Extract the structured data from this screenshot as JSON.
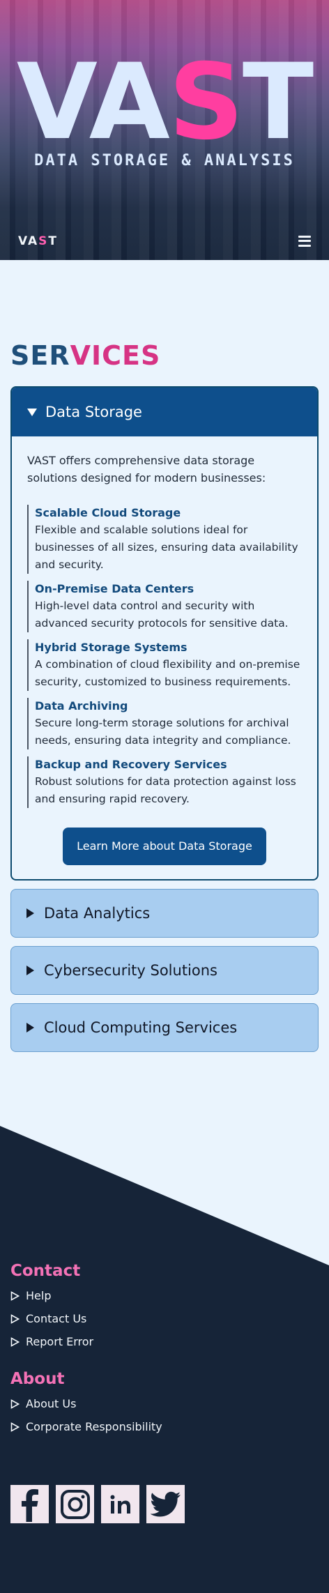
{
  "hero": {
    "title_before": "VA",
    "title_accent": "S",
    "title_after": "T",
    "subtitle": "DATA STORAGE & ANALYSIS"
  },
  "nav": {
    "logo_before": "VA",
    "logo_accent": "S",
    "logo_after": "T",
    "menu_icon": "hamburger-icon"
  },
  "services": {
    "title_before": "SER",
    "title_accent": "VICES",
    "open_item": {
      "label": "Data Storage",
      "intro": "VAST offers comprehensive data storage solutions designed for modern businesses:",
      "features": [
        {
          "title": "Scalable Cloud Storage",
          "desc": "Flexible and scalable solutions ideal for businesses of all sizes, ensuring data availability and security."
        },
        {
          "title": "On-Premise Data Centers",
          "desc": "High-level data control and security with advanced security protocols for sensitive data."
        },
        {
          "title": "Hybrid Storage Systems",
          "desc": "A combination of cloud flexibility and on-premise security, customized to business requirements."
        },
        {
          "title": "Data Archiving",
          "desc": "Secure long-term storage solutions for archival needs, ensuring data integrity and compliance."
        },
        {
          "title": "Backup and Recovery Services",
          "desc": "Robust solutions for data protection against loss and ensuring rapid recovery."
        }
      ],
      "button_label": "Learn More about Data Storage"
    },
    "closed_items": [
      {
        "label": "Data Analytics"
      },
      {
        "label": "Cybersecurity Solutions"
      },
      {
        "label": "Cloud Computing Services"
      }
    ]
  },
  "footer": {
    "contact": {
      "heading": "Contact",
      "links": [
        "Help",
        "Contact Us",
        "Report Error"
      ]
    },
    "about": {
      "heading": "About",
      "links": [
        "About Us",
        "Corporate Responsibility"
      ]
    },
    "socials": [
      "facebook-icon",
      "instagram-icon",
      "linkedin-icon",
      "twitter-icon"
    ]
  },
  "colors": {
    "accent_pink": "#ff3ea0",
    "primary_blue": "#0e4f8c",
    "footer_bg": "#162438",
    "page_bg": "#eaf4fd"
  }
}
